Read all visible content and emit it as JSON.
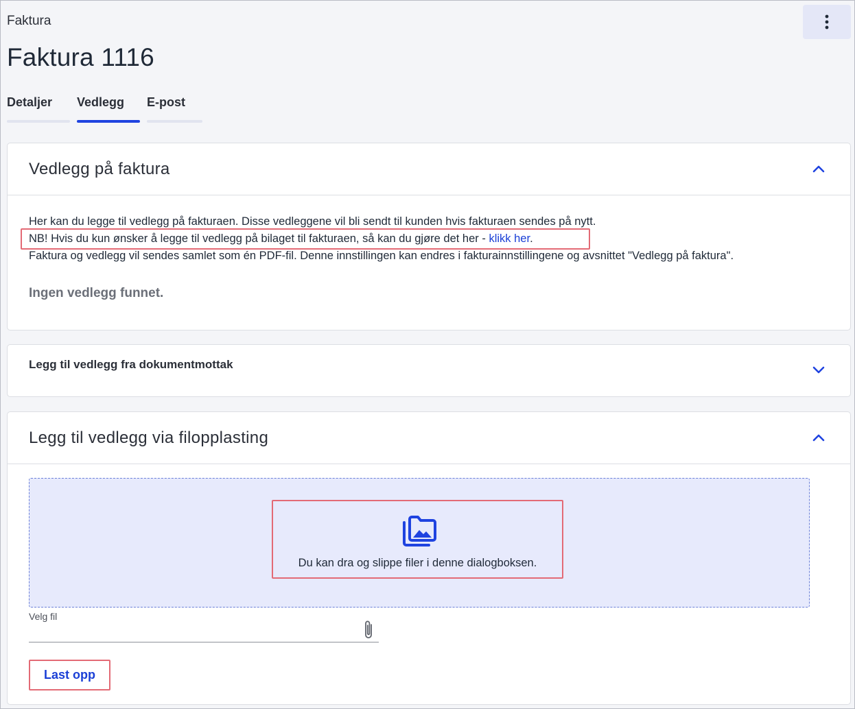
{
  "header": {
    "breadcrumb": "Faktura",
    "title": "Faktura 1116",
    "more_icon": "vertical-dots-icon"
  },
  "tabs": [
    {
      "label": "Detaljer",
      "active": false
    },
    {
      "label": "Vedlegg",
      "active": true
    },
    {
      "label": "E-post",
      "active": false
    }
  ],
  "attachments_card": {
    "title": "Vedlegg på faktura",
    "line1": "Her kan du legge til vedlegg på fakturaen. Disse vedleggene vil bli sendt til kunden hvis fakturaen sendes på nytt.",
    "line2_prefix": "NB! Hvis du kun ønsker å legge til vedlegg på bilaget til fakturaen, så kan du gjøre det her - ",
    "line2_link": "klikk her",
    "line2_suffix": ".",
    "line3": "Faktura og vedlegg vil sendes samlet som én PDF-fil. Denne innstillingen kan endres i fakturainnstillingene og avsnittet \"Vedlegg på faktura\".",
    "empty_text": "Ingen vedlegg funnet.",
    "expanded": true
  },
  "document_card": {
    "title": "Legg til vedlegg fra dokumentmottak",
    "expanded": false
  },
  "upload_card": {
    "title": "Legg til vedlegg via filopplasting",
    "expanded": true,
    "dropzone_text": "Du kan dra og slippe filer i denne dialogboksen.",
    "dropzone_icon": "image-folder-icon",
    "file_label": "Velg fil",
    "file_value": "",
    "attach_icon": "paperclip-icon",
    "upload_button": "Last opp"
  },
  "colors": {
    "accent": "#1f43e0",
    "link": "#1a3fd6",
    "highlight": "#e36a75",
    "dropzone_bg": "#e7eafc"
  }
}
